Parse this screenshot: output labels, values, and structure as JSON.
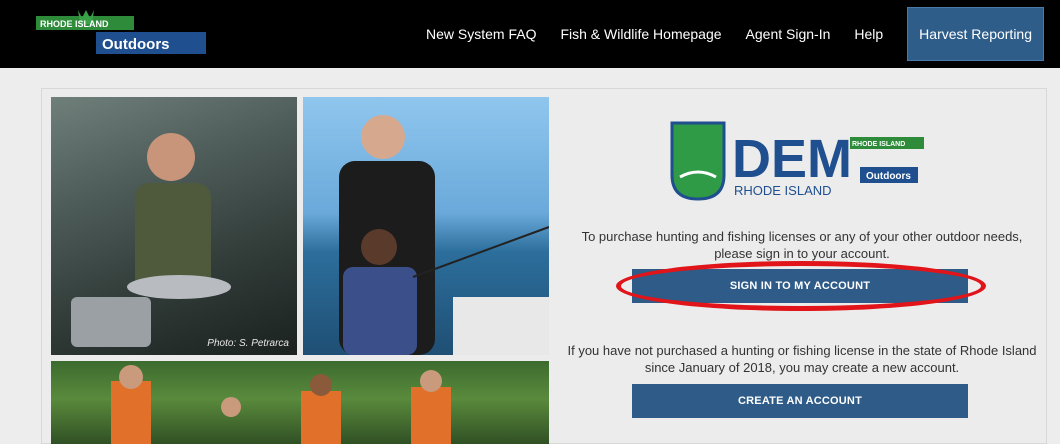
{
  "header": {
    "logo_top": "RHODE ISLAND",
    "logo_bottom": "Outdoors",
    "nav": [
      {
        "label": "New System FAQ"
      },
      {
        "label": "Fish & Wildlife Homepage"
      },
      {
        "label": "Agent Sign-In"
      },
      {
        "label": "Help"
      },
      {
        "label": "Harvest Reporting"
      }
    ]
  },
  "photos": {
    "caption": "Photo: S. Petrarca"
  },
  "dem_logo": {
    "main": "DEM",
    "sub": "RHODE ISLAND",
    "badge_top": "RHODE ISLAND",
    "badge_bottom": "Outdoors"
  },
  "main": {
    "signin_text": "To purchase hunting and fishing licenses or any of your other outdoor needs, please sign in to your account.",
    "signin_button": "SIGN IN TO MY ACCOUNT",
    "create_text": "If you have not purchased a hunting or fishing license in the state of Rhode Island since January of 2018, you may create a new account.",
    "create_button": "CREATE AN ACCOUNT"
  },
  "colors": {
    "topbar": "#000000",
    "primary_button": "#2e5b87",
    "highlight_oval": "#e01419",
    "logo_green": "#2e8b3a",
    "dem_blue": "#1f4f8f"
  }
}
